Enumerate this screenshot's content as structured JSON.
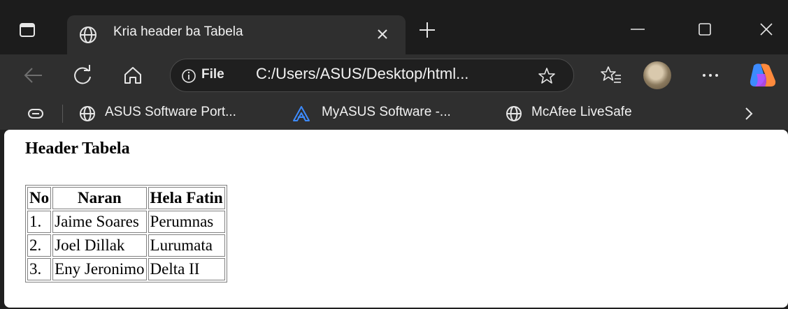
{
  "browser": {
    "tab": {
      "title": "Kria header ba Tabela",
      "icon": "globe-icon"
    },
    "address": {
      "info_icon": "info-icon",
      "scheme_label": "File",
      "url": "C:/Users/ASUS/Desktop/html..."
    },
    "bookmarks": [
      {
        "label": "ASUS Software Port...",
        "icon": "globe-icon"
      },
      {
        "label": "MyASUS Software -...",
        "icon": "myasus-logo-icon"
      },
      {
        "label": "McAfee LiveSafe",
        "icon": "globe-icon"
      }
    ],
    "colors": {
      "titlebar": "#1c1c1c",
      "toolbar": "#2f2f2f",
      "page": "#ffffff",
      "asus_blue": "#3d8bff"
    }
  },
  "page": {
    "heading": "Header Tabela",
    "table": {
      "headers": [
        "No",
        "Naran",
        "Hela Fatin"
      ],
      "rows": [
        [
          "1.",
          "Jaime Soares",
          "Perumnas"
        ],
        [
          "2.",
          "Joel Dillak",
          "Lurumata"
        ],
        [
          "3.",
          "Eny Jeronimo",
          "Delta II"
        ]
      ]
    }
  }
}
